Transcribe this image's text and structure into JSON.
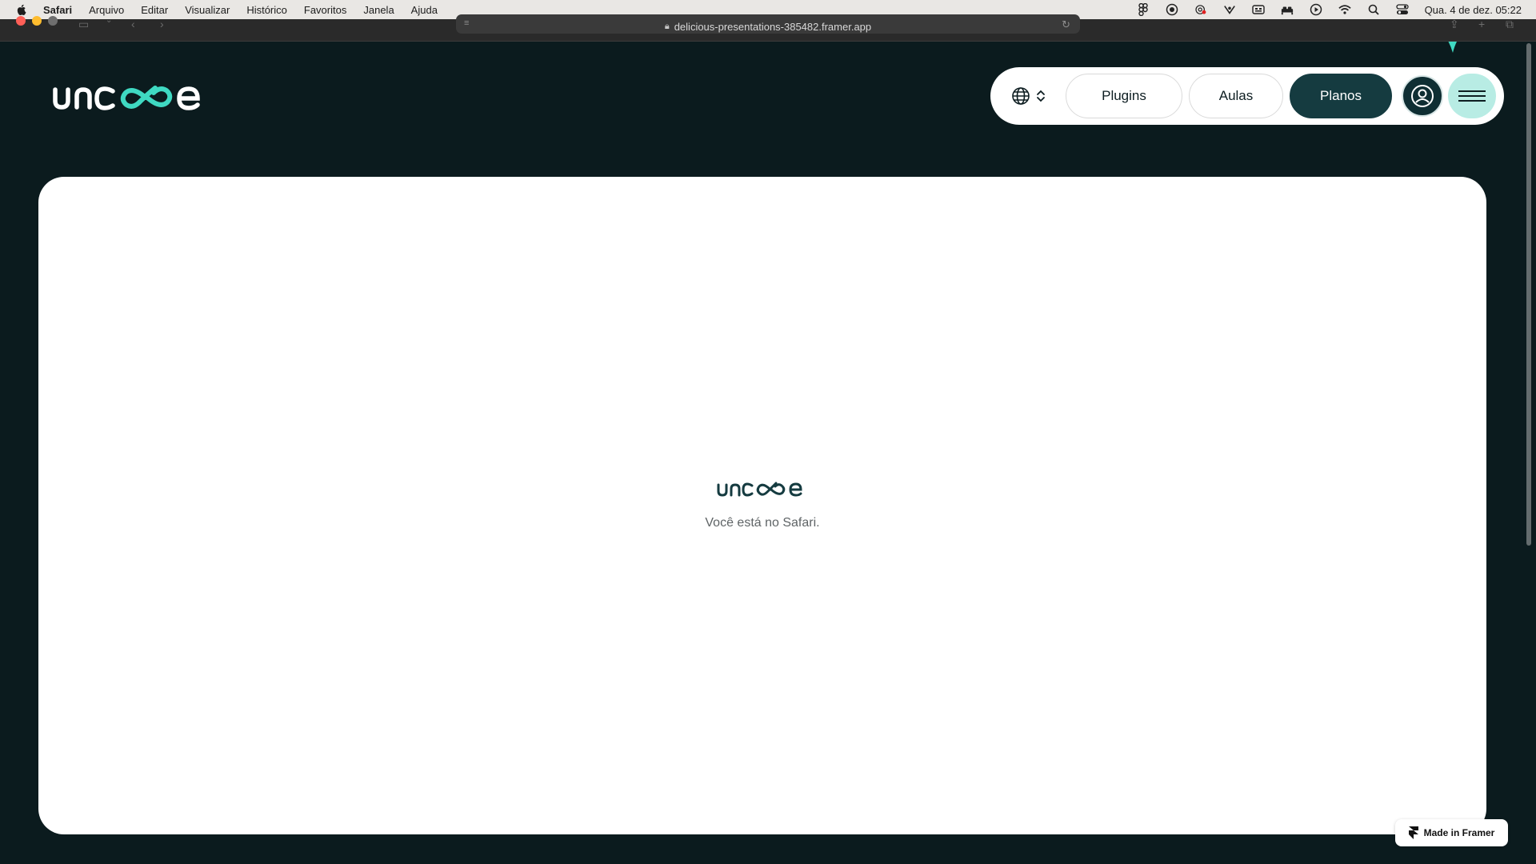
{
  "menubar": {
    "app_name": "Safari",
    "items": [
      "Arquivo",
      "Editar",
      "Visualizar",
      "Histórico",
      "Favoritos",
      "Janela",
      "Ajuda"
    ],
    "clock": "Qua. 4 de dez.  05:22",
    "status_icons": [
      "figma-icon",
      "record-icon",
      "cloud-icon",
      "vpn-icon",
      "keyboard-icon",
      "bed-icon",
      "play-icon",
      "wifi-icon",
      "search-icon",
      "control-center-icon"
    ]
  },
  "browser": {
    "url": "delicious-presentations-385482.framer.app"
  },
  "nav": {
    "plugins_label": "Plugins",
    "aulas_label": "Aulas",
    "planos_label": "Planos"
  },
  "card": {
    "message": "Você está no Safari."
  },
  "badge": {
    "label": "Made in Framer"
  },
  "colors": {
    "background": "#0b1b1e",
    "accent_teal": "#3fd9c2",
    "dark_button": "#153b40",
    "menu_button": "#b8ece4"
  }
}
